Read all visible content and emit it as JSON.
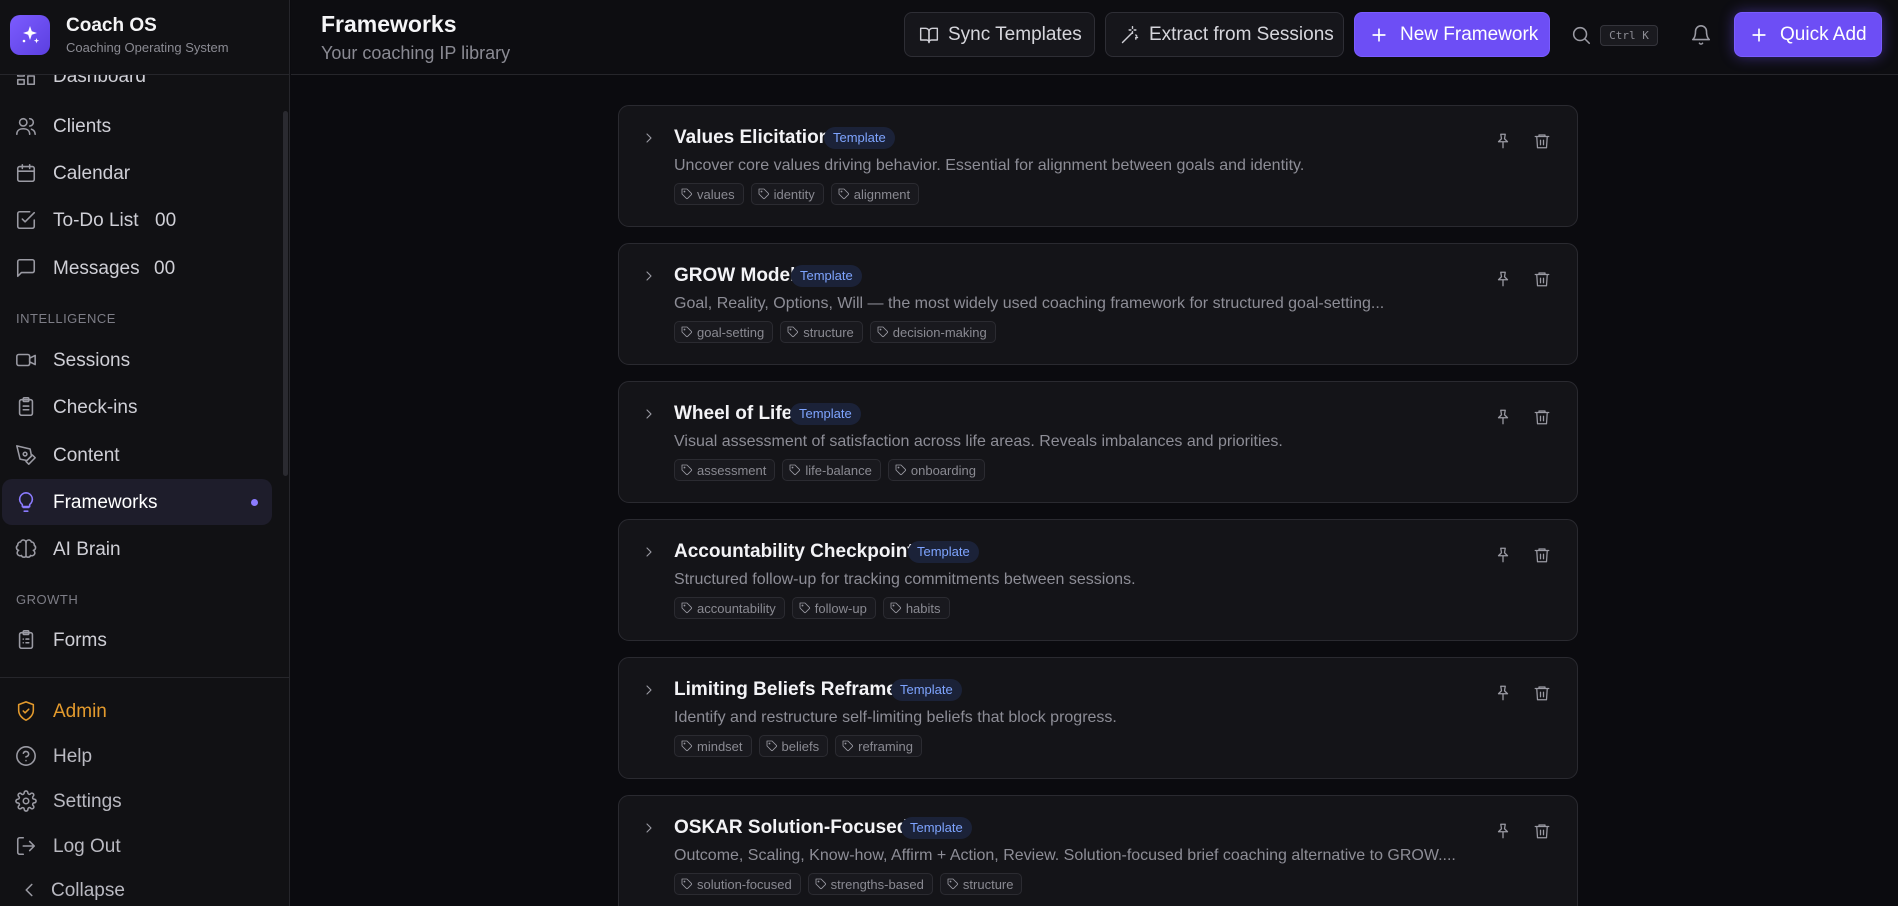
{
  "app": {
    "name": "Coach OS",
    "tagline": "Coaching Operating System"
  },
  "sidebar": {
    "items": [
      {
        "label": "Dashboard",
        "icon": "dashboard-icon"
      },
      {
        "label": "Clients",
        "icon": "users-icon"
      },
      {
        "label": "Calendar",
        "icon": "calendar-icon"
      },
      {
        "label": "To-Do List",
        "icon": "checkbox-icon",
        "count": "00"
      },
      {
        "label": "Messages",
        "icon": "message-icon",
        "count": "00"
      }
    ],
    "intelligence_label": "INTELLIGENCE",
    "intelligence_items": [
      {
        "label": "Sessions",
        "icon": "video-icon"
      },
      {
        "label": "Check-ins",
        "icon": "clipboard-icon"
      },
      {
        "label": "Content",
        "icon": "pen-icon"
      },
      {
        "label": "Frameworks",
        "icon": "lightbulb-icon",
        "active": true
      },
      {
        "label": "AI Brain",
        "icon": "brain-icon"
      }
    ],
    "growth_label": "GROWTH",
    "growth_items": [
      {
        "label": "Forms",
        "icon": "form-icon"
      }
    ],
    "bottom_items": [
      {
        "label": "Admin",
        "icon": "shield-icon"
      },
      {
        "label": "Help",
        "icon": "help-icon"
      },
      {
        "label": "Settings",
        "icon": "gear-icon"
      },
      {
        "label": "Log Out",
        "icon": "logout-icon"
      },
      {
        "label": "Collapse",
        "icon": "chevron-left-icon"
      }
    ]
  },
  "header": {
    "title": "Frameworks",
    "subtitle": "Your coaching IP library",
    "sync_label": "Sync Templates",
    "extract_label": "Extract from Sessions",
    "new_label": "New Framework",
    "shortcut": "Ctrl K",
    "quick_add_label": "Quick Add"
  },
  "colors": {
    "accent": "#6d4ef5",
    "admin": "#e39a2d",
    "badge_text": "#7ea4ff"
  },
  "frameworks": [
    {
      "title": "Values Elicitation",
      "badge": "Template",
      "description": "Uncover core values driving behavior. Essential for alignment between goals and identity.",
      "tags": [
        "values",
        "identity",
        "alignment"
      ]
    },
    {
      "title": "GROW Model",
      "badge": "Template",
      "description": "Goal, Reality, Options, Will — the most widely used coaching framework for structured goal-setting...",
      "tags": [
        "goal-setting",
        "structure",
        "decision-making"
      ]
    },
    {
      "title": "Wheel of Life",
      "badge": "Template",
      "description": "Visual assessment of satisfaction across life areas. Reveals imbalances and priorities.",
      "tags": [
        "assessment",
        "life-balance",
        "onboarding"
      ]
    },
    {
      "title": "Accountability Checkpoint",
      "badge": "Template",
      "description": "Structured follow-up for tracking commitments between sessions.",
      "tags": [
        "accountability",
        "follow-up",
        "habits"
      ]
    },
    {
      "title": "Limiting Beliefs Reframe",
      "badge": "Template",
      "description": "Identify and restructure self-limiting beliefs that block progress.",
      "tags": [
        "mindset",
        "beliefs",
        "reframing"
      ]
    },
    {
      "title": "OSKAR Solution-Focused",
      "badge": "Template",
      "description": "Outcome, Scaling, Know-how, Affirm + Action, Review. Solution-focused brief coaching alternative to GROW....",
      "tags": [
        "solution-focused",
        "strengths-based",
        "structure"
      ]
    }
  ]
}
